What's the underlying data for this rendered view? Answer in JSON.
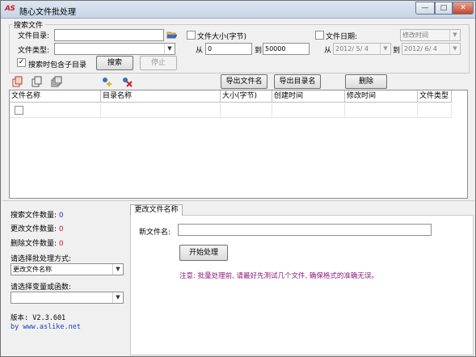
{
  "window": {
    "app_icon": "AS",
    "title": "随心文件批处理",
    "buttons": {
      "minimize": "—",
      "maximize": "□",
      "close": "✕"
    }
  },
  "search": {
    "group_label": "搜索文件",
    "dir_label": "文件目录:",
    "dir_value": "",
    "type_label": "文件类型:",
    "type_value": "",
    "include_sub_label": "搜索时包含子目录",
    "include_sub_checked": true,
    "search_button": "搜索",
    "stop_button": "停止",
    "size_label": "文件大小(字节)",
    "size_checked": false,
    "size_from_label": "从",
    "size_from_value": "0",
    "size_to_label": "到",
    "size_to_value": "50000",
    "date_label": "文件日期:",
    "date_checked": false,
    "date_type_value": "修改时间",
    "date_from_label": "从",
    "date_from_value": "2012/ 5/ 4",
    "date_to_label": "到",
    "date_to_value": "2012/ 6/ 4"
  },
  "toolbar": {
    "icons": [
      "pages-red-icon",
      "pages-copy-icon",
      "pages-stack-icon",
      "add-icon",
      "delete-x-icon"
    ],
    "export_names_button": "导出文件名",
    "export_dirs_button": "导出目录名",
    "delete_button": "删除"
  },
  "table": {
    "columns": [
      "文件名称",
      "目录名称",
      "大小(字节)",
      "创建时间",
      "修改时间",
      "文件类型"
    ],
    "rows": []
  },
  "stats": {
    "search_count_label": "搜索文件数量:",
    "search_count": "0",
    "changed_count_label": "更改文件数量:",
    "changed_count": "0",
    "deleted_count_label": "删除文件数量:",
    "deleted_count": "0",
    "method_label": "请选择批处理方式:",
    "method_value": "更改文件名称",
    "variable_label": "请选择变量或函数:",
    "variable_value": "",
    "version": "版本: V2.3.601",
    "website": "by www.aslike.net"
  },
  "rename_tab": {
    "tab_label": "更改文件名称",
    "new_name_label": "新文件名:",
    "new_name_value": "",
    "start_button": "开始处理",
    "note": "注意: 批量处理前, 请最好先测试几个文件, 确保格式的准确无误。"
  }
}
